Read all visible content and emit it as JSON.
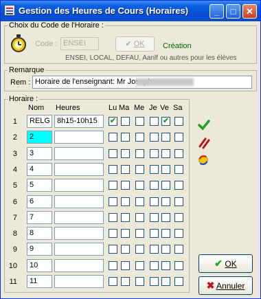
{
  "window": {
    "title": "Gestion des Heures de Cours (Horaires)"
  },
  "choix": {
    "legend": "Choix du Code de l'Horaire :",
    "code_label": "Code :",
    "code_value": "ENSEI",
    "ok_label": "OK",
    "creation_label": "Création",
    "hint": "ENSEI, LOCAL, DEFAU, Aanlf ou autres pour les élèves"
  },
  "remarque": {
    "legend": "Remarque",
    "label": "Rem :",
    "value": "Horaire de l'enseignant: Mr                    Joseph."
  },
  "horaire": {
    "legend": "Horaire :",
    "headers": {
      "nom": "Nom",
      "heures": "Heures",
      "days": [
        "Lu",
        "Ma",
        "Me",
        "Je",
        "Ve",
        "Sa"
      ]
    },
    "rows": [
      {
        "num": "1",
        "nom": "RELG",
        "heures": "8h15-10h15",
        "days": [
          true,
          false,
          false,
          false,
          true,
          false
        ]
      },
      {
        "num": "2",
        "nom": "2",
        "heures": "",
        "days": [
          false,
          false,
          false,
          false,
          false,
          false
        ]
      },
      {
        "num": "3",
        "nom": "3",
        "heures": "",
        "days": [
          false,
          false,
          false,
          false,
          false,
          false
        ]
      },
      {
        "num": "4",
        "nom": "4",
        "heures": "",
        "days": [
          false,
          false,
          false,
          false,
          false,
          false
        ]
      },
      {
        "num": "5",
        "nom": "5",
        "heures": "",
        "days": [
          false,
          false,
          false,
          false,
          false,
          false
        ]
      },
      {
        "num": "6",
        "nom": "6",
        "heures": "",
        "days": [
          false,
          false,
          false,
          false,
          false,
          false
        ]
      },
      {
        "num": "7",
        "nom": "7",
        "heures": "",
        "days": [
          false,
          false,
          false,
          false,
          false,
          false
        ]
      },
      {
        "num": "8",
        "nom": "8",
        "heures": "",
        "days": [
          false,
          false,
          false,
          false,
          false,
          false
        ]
      },
      {
        "num": "9",
        "nom": "9",
        "heures": "",
        "days": [
          false,
          false,
          false,
          false,
          false,
          false
        ]
      },
      {
        "num": "10",
        "nom": "10",
        "heures": "",
        "days": [
          false,
          false,
          false,
          false,
          false,
          false
        ]
      },
      {
        "num": "11",
        "nom": "11",
        "heures": "",
        "days": [
          false,
          false,
          false,
          false,
          false,
          false
        ]
      }
    ]
  },
  "actions": {
    "ok_label": "OK",
    "cancel_label": "Annuler"
  },
  "colors": {
    "accent": "#0a5fe0",
    "check": "#21a121",
    "active_field": "#00ffff",
    "link": "#006600"
  }
}
